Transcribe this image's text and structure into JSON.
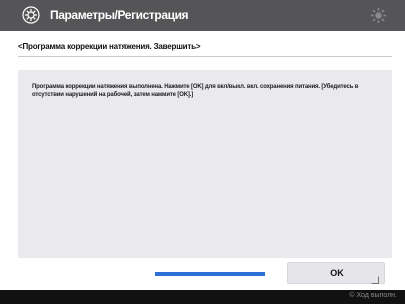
{
  "header": {
    "title": "Параметры/Регистрация",
    "settings_icon": "settings-registration-icon",
    "status_icon": "sun-gear-icon"
  },
  "subheader": "<Программа коррекции натяжения. Завершить>",
  "message": "Программа коррекции натяжения выполнена. Нажмите [OK] для вкл/выкл. вкл. сохранения питания. [Убедитесь в отсутствии нарушений на рабочей, затем нажмите [OK].]",
  "progress": {
    "fraction": 1.0,
    "color": "#2c6fd6"
  },
  "ok_button": {
    "label": "OK"
  },
  "footer": {
    "status_monitor_label": "© Ход выполн."
  },
  "colors": {
    "title_bar": "#555558",
    "panel": "#e9e9ee",
    "footer": "#111111"
  }
}
